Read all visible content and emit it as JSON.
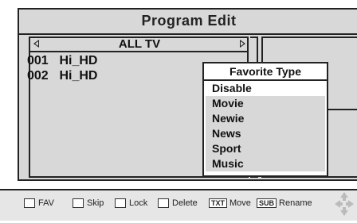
{
  "window": {
    "title": "Program Edit"
  },
  "channel_list": {
    "category": "ALL TV",
    "channels": [
      {
        "number": "001",
        "name": "Hi_HD"
      },
      {
        "number": "002",
        "name": "Hi_HD"
      }
    ]
  },
  "favorite_popup": {
    "title": "Favorite Type",
    "selected": "Disable",
    "options": [
      "Disable",
      "Movie",
      "Newie",
      "News",
      "Sport",
      "Music"
    ]
  },
  "footer": {
    "fav_label": "FAV",
    "skip_label": "Skip",
    "lock_label": "Lock",
    "delete_label": "Delete",
    "txt_key": "TXT",
    "move_label": "Move",
    "sub_key": "SUB",
    "rename_label": "Rename"
  },
  "icons": {
    "left": "arrow-left-icon",
    "right": "arrow-right-icon",
    "nav": "dpad-icon"
  }
}
